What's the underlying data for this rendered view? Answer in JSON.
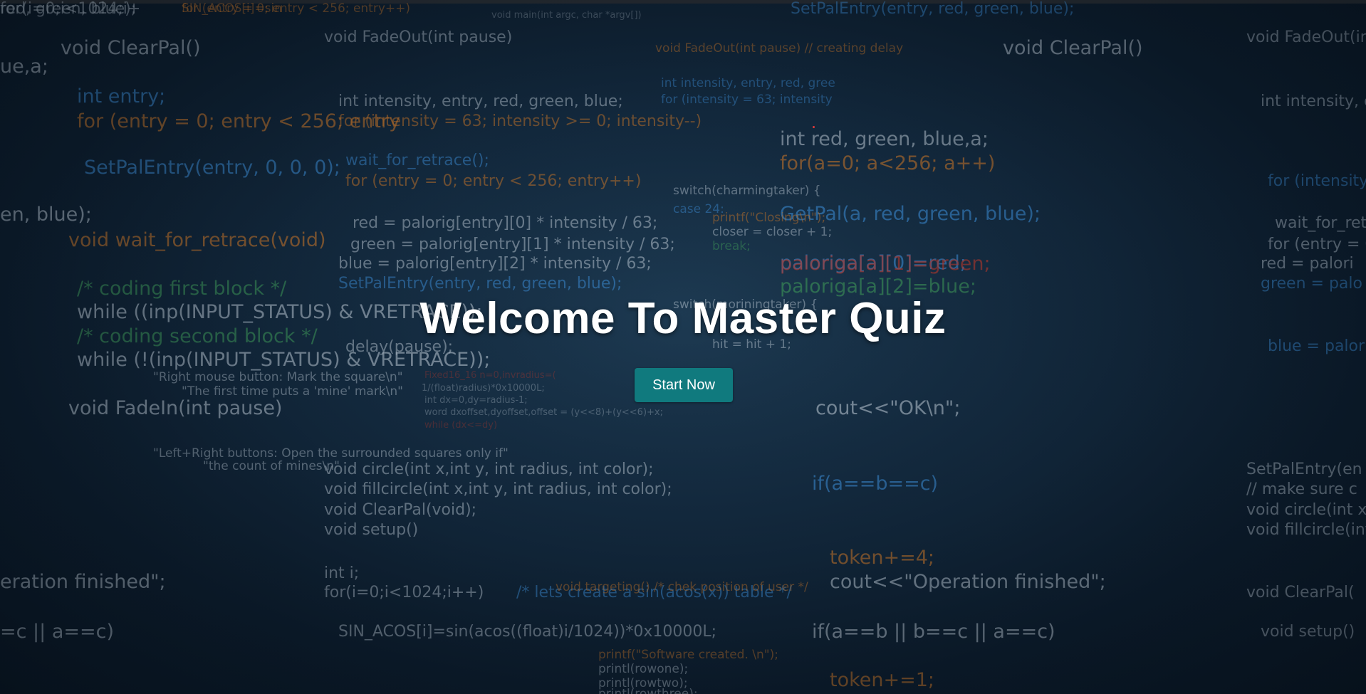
{
  "hero": {
    "title": "Welcome To Master Quiz",
    "button_label": "Start Now"
  },
  "colors": {
    "background": "#0c1c2c",
    "button": "#107a7e",
    "title": "#ffffff"
  },
  "background_code": [
    "red, green, blue);",
    "for (entry = 0; entry < 256; entry++)",
    "void main(int argc, char *argv[])",
    "SetPalEntry(entry, red, green, blue);",
    "void ClearPal()",
    "void FadeOut(int pause)",
    "int entry;",
    "int intensity, entry, red, green, blue;",
    "for (entry = 0; entry < 256; entry",
    "for (intensity = 63; intensity >= 0; intensity--)",
    "int red, green, blue,a;",
    "for(a=0; a<256; a++)",
    "SetPalEntry(entry, 0, 0, 0);",
    "wait_for_retrace();",
    "for (entry = 0; entry < 256; entry++)",
    "GetPal(a, red, green, blue);",
    "paloriga[a][0]=red;",
    "paloriga[a][1]=green;",
    "paloriga[a][2]=blue;",
    "void wait_for_retrace(void)",
    "red   = palorig[entry][0] * intensity / 63;",
    "green = palorig[entry][1] * intensity / 63;",
    "blue  = palorig[entry][2] * intensity / 63;",
    "SetPalEntry(entry, red, green, blue);",
    "/* coding first block */",
    "while  ((inp(INPUT_STATUS) & VRETRACE));",
    "/* coding second block */",
    "while (!(inp(INPUT_STATUS) & VRETRACE));",
    "delay(pause);",
    "void FadeIn(int pause)",
    "cout<<\"OK\\n\";",
    "void circle(int x,int y, int radius, int color);",
    "void fillcircle(int x,int y, int radius, int color);",
    "void ClearPal(void);",
    "void setup()",
    "if(a==b==c)",
    "int i;",
    "for(i=0;i<1024;i++)",
    "SIN_ACOS[i]=sin(acos((float)i/1024))*0x10000L;",
    "token+=4;",
    "cout<<\"Operation finished\";",
    "if(a==b || b==c || a==c)",
    "token+=1;",
    "/* lets create a sin(acos(x)) table */",
    "eration finished\";",
    "=c || a==c)",
    "switch(charmingtaker) {",
    "case 24:",
    "printf(\"Closing\\n\");",
    "closer = closer + 1;",
    "break;",
    "switch(moriningtaker) {",
    "hit = hit + 1;",
    "printf(\"Software created. \\n\");",
    "printl(rowone);",
    "printl(rowtwo);",
    "printl(rowthree);",
    "void targeting() /* chek position of user */",
    "Fixed16_16 n=0,invradius=(",
    "1/(float)radius)*0x10000L;",
    "int dx=0,dy=radius-1;",
    "word dxoffset,dyoffset,offset = (y<<8)+(y<<6)+x;",
    "while (dx<=dy)",
    "\"Right mouse button: Mark the square\\n\"",
    "\"The first time puts a 'mine' mark\\n\"",
    "\"Left+Right buttons: Open the surrounded squares only if\"",
    "\"the count of mines\\n\"",
    "int intensity, entry, red, gree",
    "for (intensity = 63; intensity",
    "void FadeOut(int pause) // creating delay",
    "ue,a;",
    "en, blue);",
    "void ClearPal()",
    "void FadeOut(int pause)",
    "int intensity, en",
    "for (intensity =",
    "wait_for_retra",
    "for (entry = 0;",
    "red   = palori",
    "green = palo",
    "blue  = palorig",
    "SetPalEntry(en",
    "// make sure c",
    "void circle(int x,",
    "void fillcircle(int x",
    "void ClearPal(",
    "void setup()",
    "for(i=0;i<1024;i+",
    "SIN_ACOS[i]=sin"
  ]
}
